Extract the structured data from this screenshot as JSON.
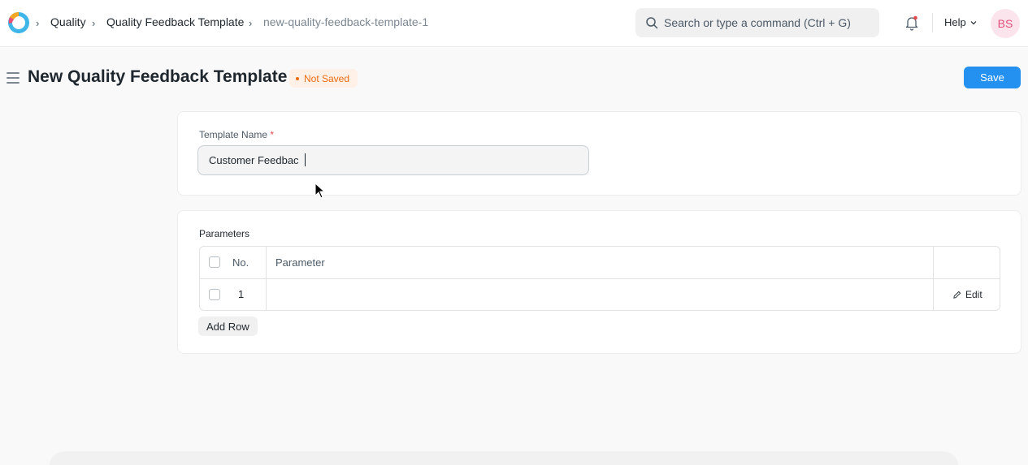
{
  "breadcrumbs": [
    "Quality",
    "Quality Feedback Template",
    "new-quality-feedback-template-1"
  ],
  "search": {
    "placeholder": "Search or type a command (Ctrl + G)"
  },
  "navbar": {
    "help_label": "Help",
    "avatar_initials": "BS"
  },
  "page": {
    "title": "New Quality Feedback Template",
    "status": "Not Saved",
    "save_label": "Save"
  },
  "form": {
    "template_name_label": "Template Name",
    "required_mark": "*",
    "template_name_value": "Customer Feedbac"
  },
  "parameters": {
    "label": "Parameters",
    "columns": [
      "No.",
      "Parameter"
    ],
    "rows": [
      {
        "no": "1",
        "parameter": ""
      }
    ],
    "edit_label": "Edit",
    "add_row_label": "Add Row"
  },
  "colors": {
    "accent": "#2490ef",
    "status": "#e86c13",
    "avatar_bg": "#fce4ec"
  },
  "icons": [
    "app-logo-icon",
    "chevron-right-icon",
    "search-icon",
    "bell-icon",
    "chevron-down-icon",
    "hamburger-icon",
    "pencil-icon",
    "mouse-cursor-icon"
  ]
}
